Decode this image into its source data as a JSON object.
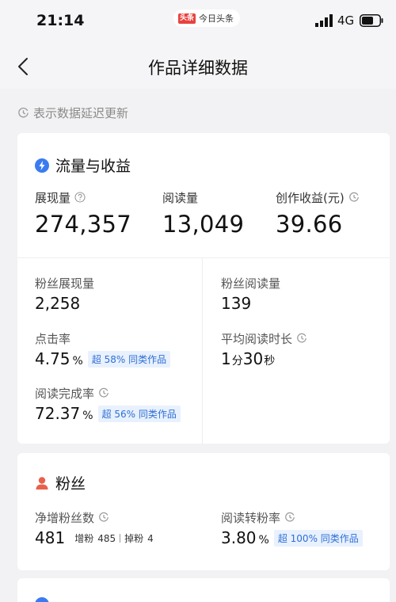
{
  "status": {
    "time": "21:14",
    "app_logo": "头条",
    "app_name": "今日头条",
    "network": "4G"
  },
  "nav": {
    "title": "作品详细数据"
  },
  "notice": "表示数据延迟更新",
  "traffic": {
    "title": "流量与收益",
    "impressions_label": "展现量",
    "impressions_value": "274,357",
    "reads_label": "阅读量",
    "reads_value": "13,049",
    "earnings_label": "创作收益(元)",
    "earnings_value": "39.66",
    "fan_impressions_label": "粉丝展现量",
    "fan_impressions_value": "2,258",
    "fan_reads_label": "粉丝阅读量",
    "fan_reads_value": "139",
    "ctr_label": "点击率",
    "ctr_value": "4.75",
    "ctr_unit": "%",
    "ctr_badge": "超 58% 同类作品",
    "avg_time_label": "平均阅读时长",
    "avg_time_min": "1",
    "avg_time_min_unit": "分",
    "avg_time_sec": "30",
    "avg_time_sec_unit": "秒",
    "completion_label": "阅读完成率",
    "completion_value": "72.37",
    "completion_unit": "%",
    "completion_badge": "超 56% 同类作品"
  },
  "fans": {
    "title": "粉丝",
    "net_label": "净增粉丝数",
    "net_value": "481",
    "gain_label": "增粉",
    "gain_value": "485",
    "loss_label": "掉粉",
    "loss_value": "4",
    "conversion_label": "阅读转粉率",
    "conversion_value": "3.80",
    "conversion_unit": "%",
    "conversion_badge": "超 100% 同类作品"
  },
  "colors": {
    "accent_blue": "#3a7bf0",
    "fan_red": "#e8604c",
    "badge_bg": "#e8f1fd",
    "badge_text": "#2f6fd6"
  },
  "icons": {
    "traffic": "lightning-icon",
    "fans": "person-icon",
    "delay": "clock-icon",
    "help": "question-icon"
  }
}
